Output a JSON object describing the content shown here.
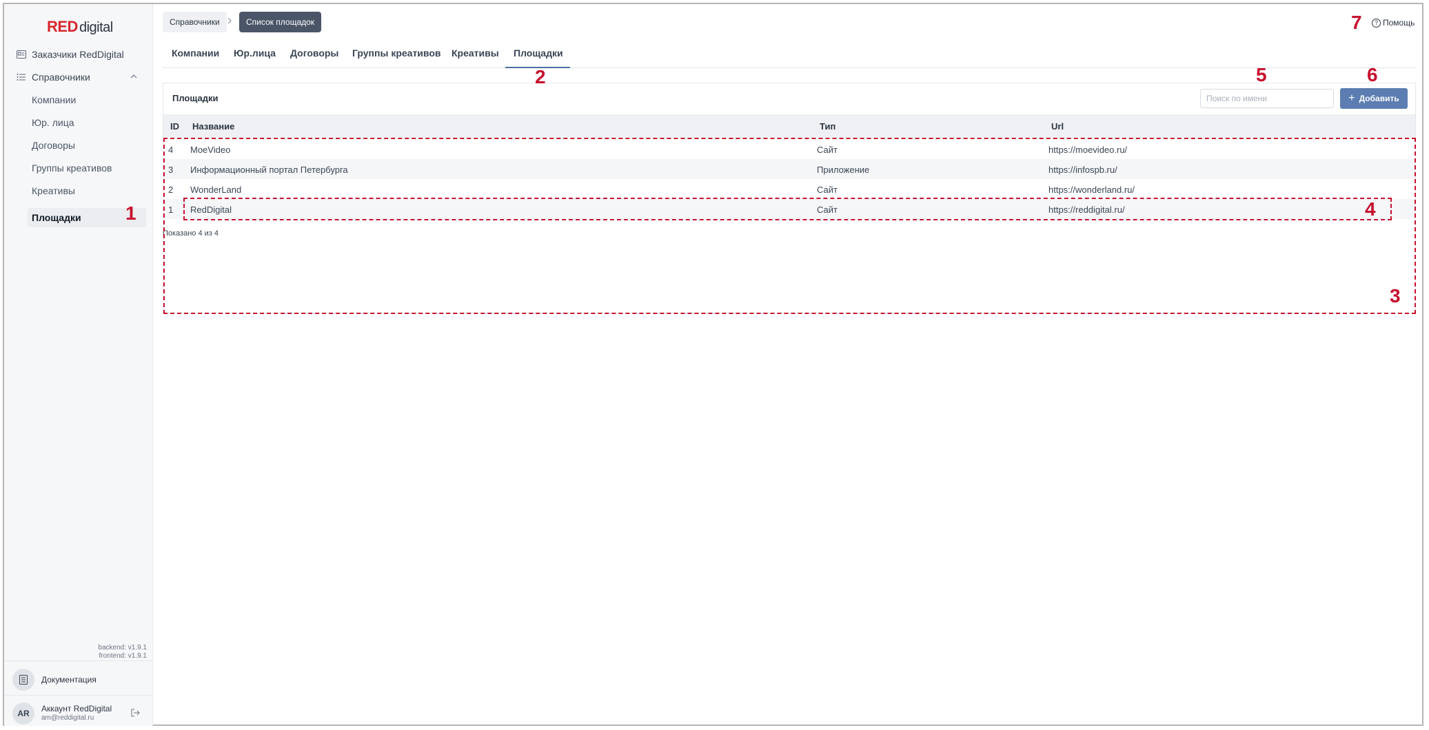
{
  "brand": {
    "red": "RED",
    "rest": "digital"
  },
  "sidebar": {
    "customers": "Заказчики RedDigital",
    "directories": "Справочники",
    "sub_items": [
      {
        "label": "Компании"
      },
      {
        "label": "Юр. лица"
      },
      {
        "label": "Договоры"
      },
      {
        "label": "Группы креативов"
      },
      {
        "label": "Креативы"
      },
      {
        "label": "Площадки"
      }
    ],
    "backend_version": "backend: v1.9.1",
    "frontend_version": "frontend: v1.9.1",
    "docs": "Документация",
    "account": {
      "initials": "AR",
      "name": "Аккаунт RedDigital",
      "email": "am@reddigital.ru"
    }
  },
  "breadcrumb": {
    "parent": "Справочники",
    "current": "Список площадок"
  },
  "help": "Помощь",
  "tabs": [
    {
      "label": "Компании"
    },
    {
      "label": "Юр.лица"
    },
    {
      "label": "Договоры"
    },
    {
      "label": "Группы креативов"
    },
    {
      "label": "Креативы"
    },
    {
      "label": "Площадки"
    }
  ],
  "panel": {
    "title": "Площадки",
    "search_placeholder": "Поиск по имени",
    "add_label": "Добавить",
    "columns": {
      "id": "ID",
      "name": "Название",
      "type": "Тип",
      "url": "Url"
    },
    "rows": [
      {
        "id": "4",
        "name": "MoeVideo",
        "type": "Сайт",
        "url": "https://moevideo.ru/"
      },
      {
        "id": "3",
        "name": "Информационный портал Петербурга",
        "type": "Приложение",
        "url": "https://infospb.ru/"
      },
      {
        "id": "2",
        "name": "WonderLand",
        "type": "Сайт",
        "url": "https://wonderland.ru/"
      },
      {
        "id": "1",
        "name": "RedDigital",
        "type": "Сайт",
        "url": "https://reddigital.ru/"
      }
    ],
    "shown": "Показано 4 из 4"
  },
  "annotations": [
    "1",
    "2",
    "3",
    "4",
    "5",
    "6",
    "7"
  ],
  "colors": {
    "accent": "#5b7db1",
    "brand_red": "#d7272d",
    "annotation": "#c8102e",
    "breadcrumb_active": "#4a5568"
  }
}
